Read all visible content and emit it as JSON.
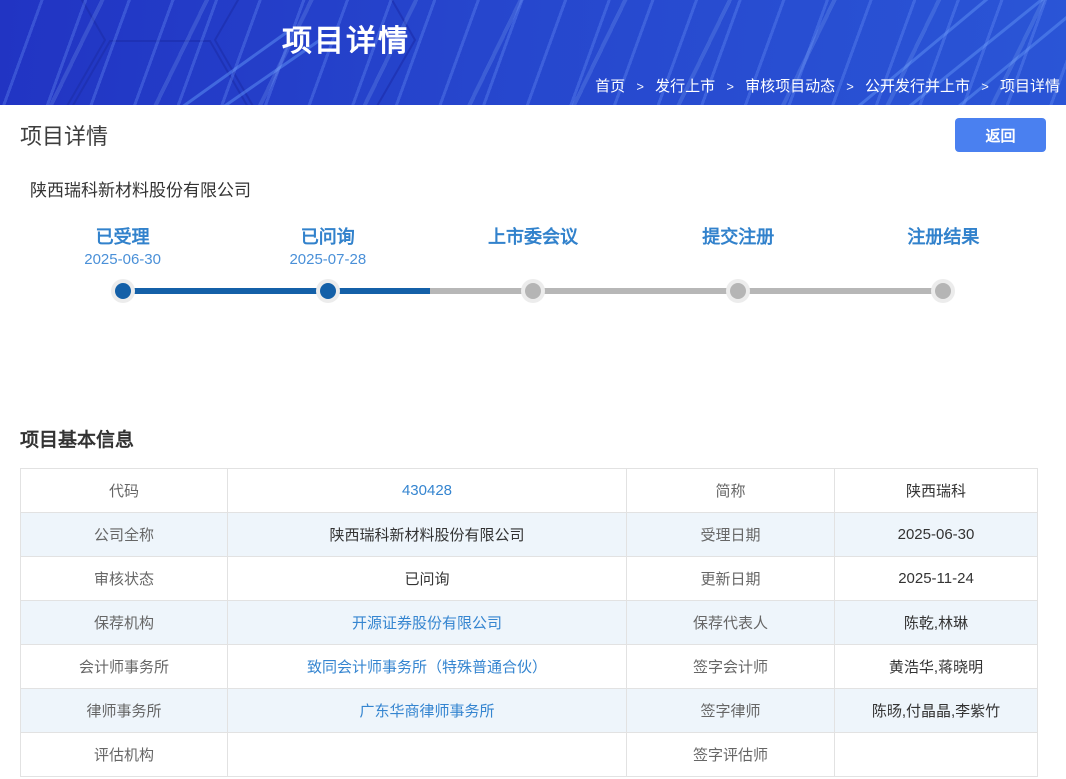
{
  "banner": {
    "title": "项目详情",
    "separator": ">",
    "breadcrumb": [
      "首页",
      "发行上市",
      "审核项目动态",
      "公开发行并上市",
      "项目详情"
    ]
  },
  "page": {
    "title": "项目详情",
    "back_label": "返回",
    "company_name": "陕西瑞科新材料股份有限公司",
    "section_title": "项目基本信息"
  },
  "timeline": {
    "steps": [
      {
        "label": "已受理",
        "date": "2025-06-30",
        "state": "done"
      },
      {
        "label": "已问询",
        "date": "2025-07-28",
        "state": "done"
      },
      {
        "label": "上市委会议",
        "date": "",
        "state": "pending"
      },
      {
        "label": "提交注册",
        "date": "",
        "state": "pending"
      },
      {
        "label": "注册结果",
        "date": "",
        "state": "pending"
      }
    ]
  },
  "table": {
    "rows": [
      {
        "c0": "代码",
        "c1": "430428",
        "c2": "简称",
        "c3": "陕西瑞科"
      },
      {
        "c0": "公司全称",
        "c1": "陕西瑞科新材料股份有限公司",
        "c2": "受理日期",
        "c3": "2025-06-30"
      },
      {
        "c0": "审核状态",
        "c1": "已问询",
        "c2": "更新日期",
        "c3": "2025-11-24"
      },
      {
        "c0": "保荐机构",
        "c1": "开源证券股份有限公司",
        "c2": "保荐代表人",
        "c3": "陈乾,林琳"
      },
      {
        "c0": "会计师事务所",
        "c1": "致同会计师事务所（特殊普通合伙）",
        "c2": "签字会计师",
        "c3": "黄浩华,蒋晓明"
      },
      {
        "c0": "律师事务所",
        "c1": "广东华商律师事务所",
        "c2": "签字律师",
        "c3": "陈旸,付晶晶,李紫竹"
      },
      {
        "c0": "评估机构",
        "c1": "",
        "c2": "签字评估师",
        "c3": ""
      }
    ]
  },
  "colors": {
    "banner_blue": "#2646cd",
    "button_blue": "#4a80f0",
    "link_blue": "#3585d0",
    "step_done": "#1460a8",
    "step_pending": "#b5b5b5",
    "stripe_row": "#eef5fb"
  }
}
